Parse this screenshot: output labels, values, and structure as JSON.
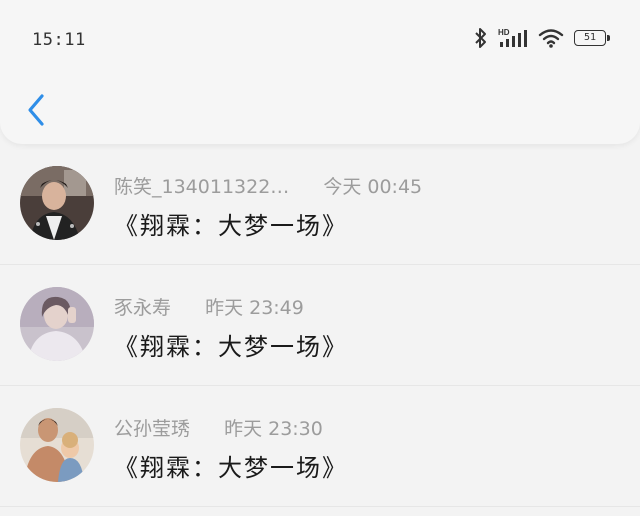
{
  "status_bar": {
    "time": "15:11",
    "network": "HD",
    "battery": "51",
    "icons": [
      "bluetooth-icon",
      "signal-icon",
      "wifi-icon",
      "battery-icon"
    ]
  },
  "nav": {
    "back_icon": "chevron-left-icon",
    "accent_color": "#2f8ee8"
  },
  "comments": [
    {
      "name": "陈笑_134011322…",
      "time": "今天 00:45",
      "content": "《翔霖：大梦一场》"
    },
    {
      "name": "豕永寿",
      "time": "昨天 23:49",
      "content": "《翔霖：大梦一场》"
    },
    {
      "name": "公孙莹琇",
      "time": "昨天 23:30",
      "content": "《翔霖：大梦一场》"
    }
  ]
}
